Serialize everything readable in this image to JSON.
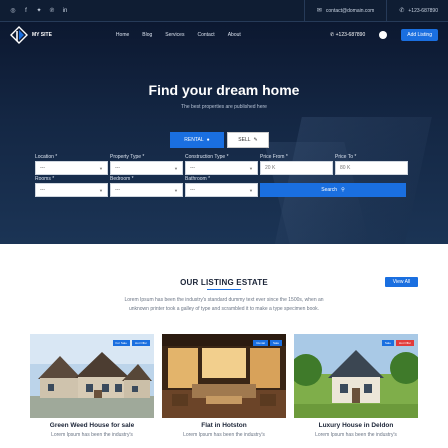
{
  "topbar": {
    "social_icons": [
      "instagram-icon",
      "facebook-icon",
      "twitter-icon",
      "pinterest-icon",
      "linkedin-icon"
    ],
    "email": "contact@domain.com",
    "phone": "+123-687890"
  },
  "nav": {
    "logo_text": "MY SITE",
    "items": [
      {
        "label": "Home"
      },
      {
        "label": "Blog"
      },
      {
        "label": "Services"
      },
      {
        "label": "Contact"
      },
      {
        "label": "About"
      }
    ],
    "phone": "+123-687890",
    "add_listing_label": "Add Listing"
  },
  "hero": {
    "title": "Find your dream home",
    "subtitle": "The best properties are published here",
    "tab_rental": "RENTAL",
    "tab_sell": "SELL"
  },
  "search_form": {
    "row1": [
      {
        "label": "Location *",
        "value": "---"
      },
      {
        "label": "Property Type *",
        "value": "---"
      },
      {
        "label": "Construction Type *",
        "value": "---"
      },
      {
        "label": "Price From *",
        "value": "20 K"
      },
      {
        "label": "Price To *",
        "value": "80 K"
      }
    ],
    "row2": [
      {
        "label": "Rooms *",
        "value": "---"
      },
      {
        "label": "Bedroom *",
        "value": "---"
      },
      {
        "label": "Bathroom *",
        "value": "---"
      }
    ],
    "search_label": "Search"
  },
  "listing": {
    "title": "OUR LISTING ESTATE",
    "view_all": "View All",
    "description": "Lorem Ipsum has been the industry's standard dummy text ever since the 1500s, when an unknown printer took a galley of type and scrambled it to make a type specimen book.",
    "cards": [
      {
        "title": "Green Weed House for sale",
        "desc": "Lorem Ipsum has been the industry's",
        "badge1": "For Sale",
        "badge2": "Hot Offer"
      },
      {
        "title": "Flat in Hotston",
        "desc": "Lorem Ipsum has been the industry's",
        "badge1": "Rental",
        "badge2": "Sale"
      },
      {
        "title": "Luxury House in Deldon",
        "desc": "Lorem Ipsum has been the industry's",
        "badge1": "Sale",
        "badge2": "Hot Offer"
      }
    ]
  },
  "colors": {
    "accent": "#1a6fe0",
    "dark_navy": "#0f1d33",
    "badge_red": "#e23b3b"
  }
}
